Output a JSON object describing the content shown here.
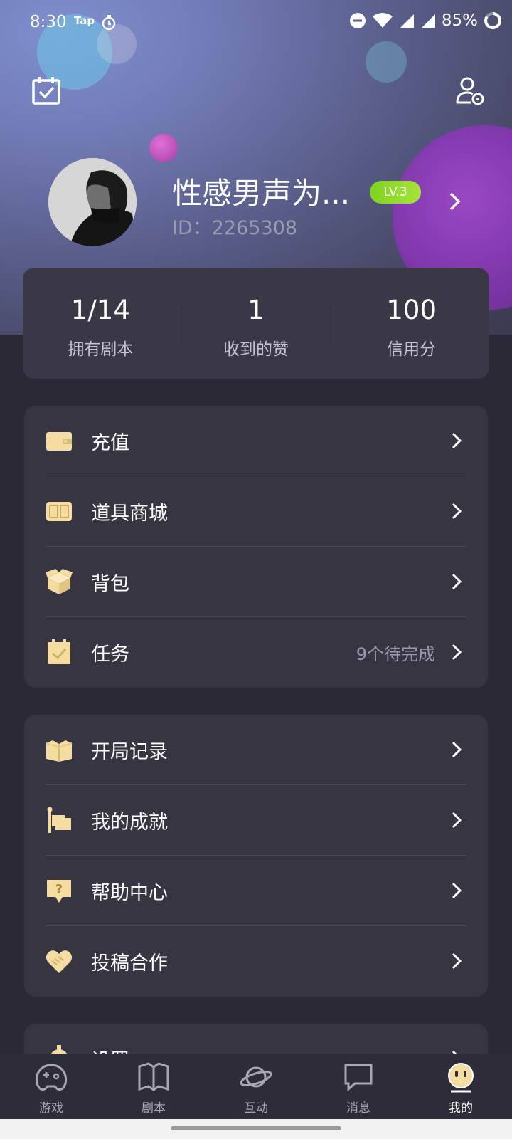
{
  "status_bar": {
    "time": "8:30",
    "tap_label": "Tap",
    "battery": "85%"
  },
  "header": {
    "nickname": "性感男声为...",
    "level": "LV.3",
    "user_id": "ID：2265308"
  },
  "stats": [
    {
      "value": "1/14",
      "label": "拥有剧本"
    },
    {
      "value": "1",
      "label": "收到的赞"
    },
    {
      "value": "100",
      "label": "信用分"
    }
  ],
  "menu_group1": [
    {
      "label": "充值",
      "extra": "",
      "icon": "wallet-icon"
    },
    {
      "label": "道具商城",
      "extra": "",
      "icon": "shop-ticket-icon"
    },
    {
      "label": "背包",
      "extra": "",
      "icon": "box-icon"
    },
    {
      "label": "任务",
      "extra": "9个待完成",
      "icon": "task-icon"
    }
  ],
  "menu_group2": [
    {
      "label": "开局记录",
      "extra": "",
      "icon": "record-icon"
    },
    {
      "label": "我的成就",
      "extra": "",
      "icon": "flag-icon"
    },
    {
      "label": "帮助中心",
      "extra": "",
      "icon": "help-icon"
    },
    {
      "label": "投稿合作",
      "extra": "",
      "icon": "handshake-icon"
    }
  ],
  "menu_group3": [
    {
      "label": "设置",
      "icon": "gear-icon"
    }
  ],
  "tabs": [
    {
      "label": "游戏",
      "icon": "gamepad-icon"
    },
    {
      "label": "剧本",
      "icon": "book-icon"
    },
    {
      "label": "互动",
      "icon": "planet-icon"
    },
    {
      "label": "消息",
      "icon": "chat-icon"
    },
    {
      "label": "我的",
      "icon": "profile-face-icon",
      "active": true
    }
  ],
  "colors": {
    "accent_gold": "#f5dca0",
    "level_green": "#8fdc2a",
    "background": "#2b2935",
    "card": "#373542"
  }
}
